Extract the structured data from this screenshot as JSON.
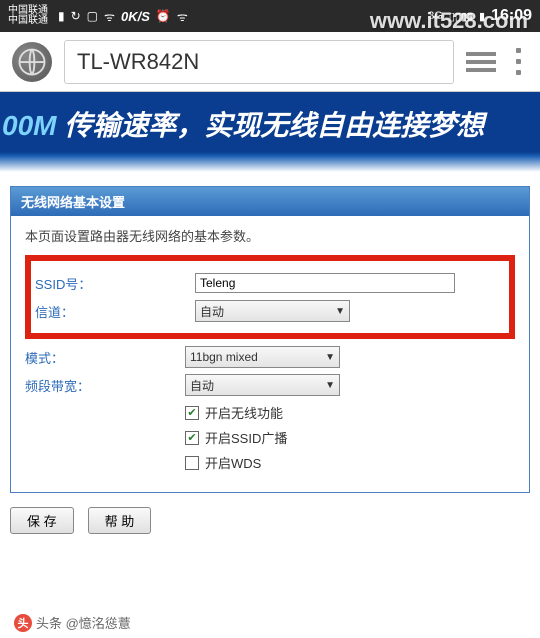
{
  "status": {
    "carrier1": "中国联通",
    "carrier2": "中国联通",
    "speed": "0K/S",
    "net_type": "3G",
    "time": "16:09"
  },
  "watermark": "www.it528.com",
  "browser": {
    "url": "TL-WR842N"
  },
  "banner": {
    "title_speed": "00M",
    "title_text": " 传输速率，实现无线自由连接梦想"
  },
  "panel": {
    "header": "无线网络基本设置",
    "intro": "本页面设置路由器无线网络的基本参数。",
    "labels": {
      "ssid": "SSID号：",
      "channel": "信道：",
      "mode": "模式：",
      "bandwidth": "频段带宽："
    },
    "values": {
      "ssid": "Teleng",
      "channel": "自动",
      "mode": "11bgn mixed",
      "bandwidth": "自动"
    },
    "checkboxes": {
      "enable_wireless": "开启无线功能",
      "enable_ssid_broadcast": "开启SSID广播",
      "enable_wds": "开启WDS"
    },
    "buttons": {
      "save": "保 存",
      "help": "帮 助"
    }
  },
  "footer": {
    "source": "头条 @憶洺慫薏"
  }
}
